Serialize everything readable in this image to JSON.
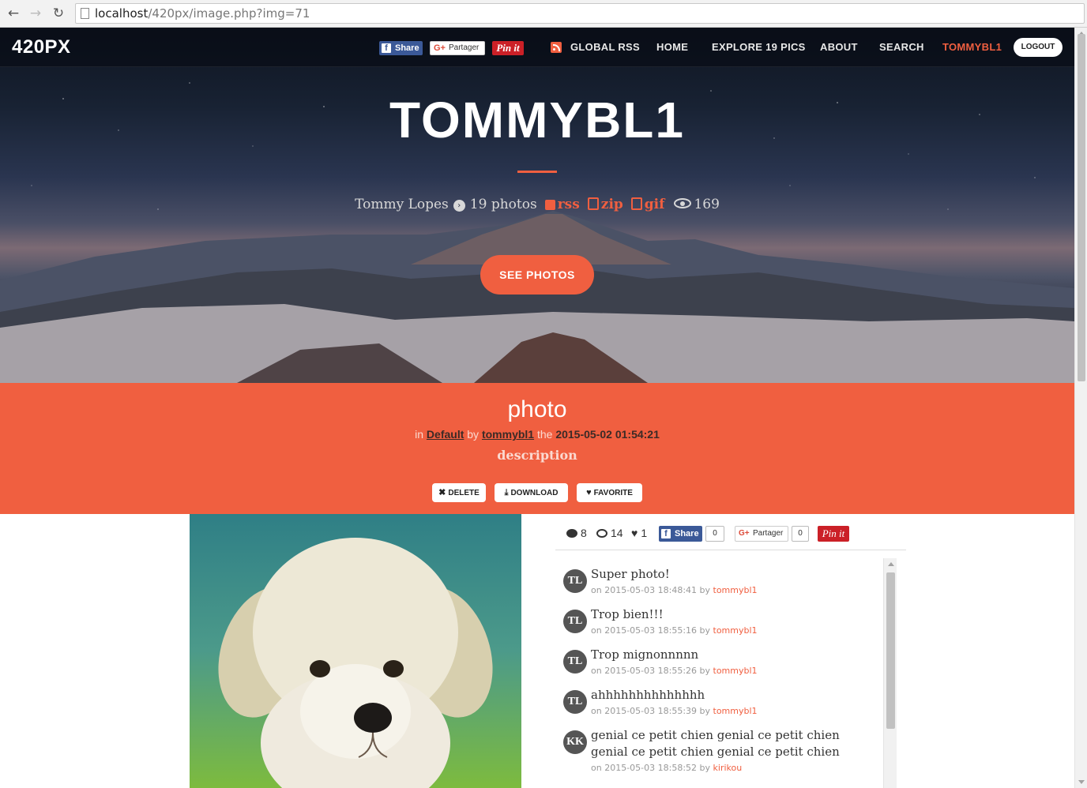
{
  "browser": {
    "url_host": "localhost",
    "url_path": "/420px/image.php?img=71"
  },
  "nav": {
    "brand": "420PX",
    "share_fb": "Share",
    "share_gplus": "Partager",
    "share_pin": "Pin it",
    "items": [
      {
        "label": "GLOBAL RSS"
      },
      {
        "label": "HOME"
      },
      {
        "label": "EXPLORE 19 PICS"
      },
      {
        "label": "ABOUT"
      },
      {
        "label": "SEARCH"
      },
      {
        "label": "TOMMYBL1"
      }
    ],
    "logout": "LOGOUT"
  },
  "hero": {
    "title": "TOMMYBL1",
    "full_name": "Tommy Lopes",
    "photos_count": "19 photos",
    "links": [
      {
        "label": "rss"
      },
      {
        "label": "zip"
      },
      {
        "label": "gif"
      }
    ],
    "views": "169",
    "cta": "SEE PHOTOS"
  },
  "photo_info": {
    "title": "photo",
    "in_label": "in",
    "album": "Default",
    "by_label": "by",
    "author": "tommybl1",
    "the_label": "the",
    "date": "2015-05-02 01:54:21",
    "description": "description",
    "actions": [
      {
        "label": "DELETE"
      },
      {
        "label": "DOWNLOAD"
      },
      {
        "label": "FAVORITE"
      }
    ]
  },
  "stats": {
    "comments": "8",
    "views": "14",
    "likes": "1",
    "share_fb": "Share",
    "fb_count": "0",
    "share_gplus": "Partager",
    "gplus_count": "0",
    "share_pin": "Pin it"
  },
  "comments": [
    {
      "initials": "TL",
      "text": "Super photo!",
      "date": "on 2015-05-03 18:48:41 by",
      "author": "tommybl1"
    },
    {
      "initials": "TL",
      "text": "Trop bien!!!",
      "date": "on 2015-05-03 18:55:16 by",
      "author": "tommybl1"
    },
    {
      "initials": "TL",
      "text": "Trop mignonnnnn",
      "date": "on 2015-05-03 18:55:26 by",
      "author": "tommybl1"
    },
    {
      "initials": "TL",
      "text": "ahhhhhhhhhhhhhh",
      "date": "on 2015-05-03 18:55:39 by",
      "author": "tommybl1"
    },
    {
      "initials": "KK",
      "text": "genial ce petit chien genial ce petit chien genial ce petit chien genial ce petit chien",
      "date": "on 2015-05-03 18:58:52 by",
      "author": "kirikou"
    }
  ],
  "colors": {
    "accent": "#f05f40",
    "facebook": "#3b5998",
    "pinterest": "#cb2027"
  }
}
